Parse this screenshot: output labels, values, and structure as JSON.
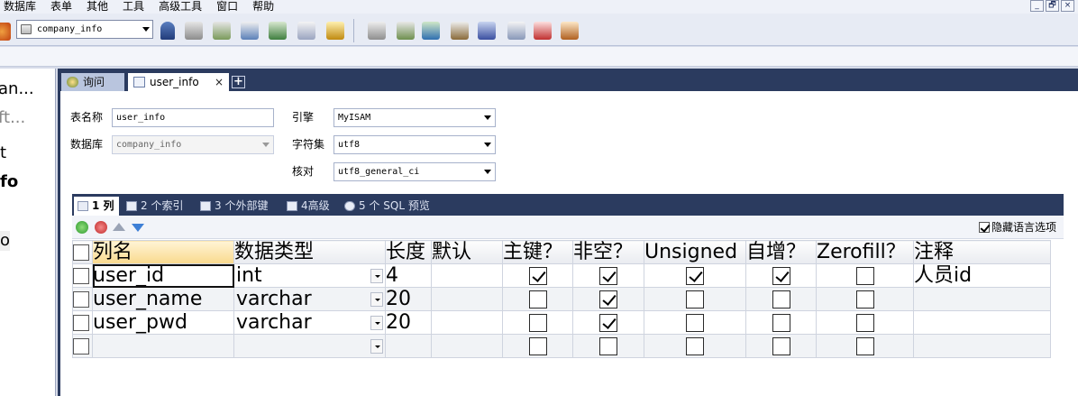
{
  "menu": [
    "数据库",
    "表单",
    "其他",
    "工具",
    "高级工具",
    "窗口",
    "帮助"
  ],
  "window_controls": [
    "_",
    "🗗",
    "×"
  ],
  "toolbar": {
    "database_selector": "company_info"
  },
  "left_pane": {
    "items": [
      "an...",
      "ft...",
      "t",
      "fo",
      "o"
    ]
  },
  "doc_tabs": {
    "query": "询问",
    "table": "user_info",
    "close": "×",
    "add": "+"
  },
  "form": {
    "table_name_label": "表名称",
    "table_name_value": "user_info",
    "database_label": "数据库",
    "database_value": "company_info",
    "engine_label": "引擎",
    "engine_value": "MyISAM",
    "charset_label": "字符集",
    "charset_value": "utf8",
    "collation_label": "核对",
    "collation_value": "utf8_general_ci"
  },
  "sub_tabs": [
    "1 列",
    "2 个索引",
    "3 个外部键",
    "4高级",
    "5 个 SQL 预览"
  ],
  "hide_lang_option": {
    "label": "隐藏语言选项",
    "checked": true
  },
  "columns_grid": {
    "headers": [
      "列名",
      "数据类型",
      "长度",
      "默认",
      "主键？",
      "非空？",
      "Unsigned",
      "自增？",
      "Zerofill？",
      "注释"
    ],
    "rows": [
      {
        "name": "user_id",
        "type": "int",
        "length": "4",
        "default": "",
        "pk": true,
        "not_null": true,
        "unsigned": true,
        "auto_inc": true,
        "zerofill": false,
        "comment": "人员id"
      },
      {
        "name": "user_name",
        "type": "varchar",
        "length": "20",
        "default": "",
        "pk": false,
        "not_null": true,
        "unsigned": false,
        "auto_inc": false,
        "zerofill": false,
        "comment": ""
      },
      {
        "name": "user_pwd",
        "type": "varchar",
        "length": "20",
        "default": "",
        "pk": false,
        "not_null": true,
        "unsigned": false,
        "auto_inc": false,
        "zerofill": false,
        "comment": ""
      },
      {
        "name": "",
        "type": "",
        "length": "",
        "default": "",
        "pk": false,
        "not_null": false,
        "unsigned": false,
        "auto_inc": false,
        "zerofill": false,
        "comment": ""
      }
    ]
  },
  "colors": {
    "tab_bar": "#2b3b5f",
    "header_sorted": "#f9d98d"
  }
}
